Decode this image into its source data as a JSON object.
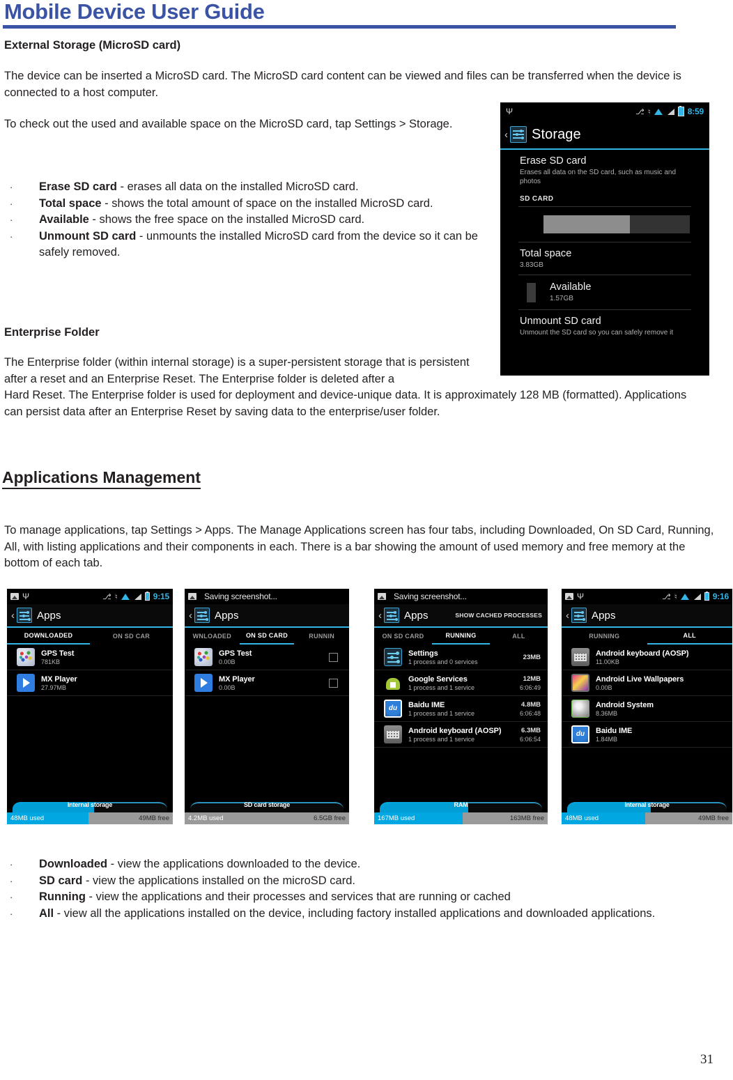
{
  "header": {
    "title": "Mobile Device User Guide"
  },
  "page_number": "31",
  "sections": {
    "external_storage": {
      "heading": "External Storage (MicroSD card)",
      "para1": "The device can be inserted a MicroSD card. The MicroSD card content can be viewed and files can be transferred when the device is connected to a host computer.",
      "para2": "To check out the used and available space on the MicroSD card, tap Settings > Storage.",
      "bullets": [
        {
          "mark": "·",
          "term": "Erase SD card",
          "rest": " - erases all data on the installed MicroSD card."
        },
        {
          "mark": "·",
          "term": "Total space",
          "rest": " - shows the total amount of space on the installed MicroSD card."
        },
        {
          "mark": "·",
          "term": "Available",
          "rest": " - shows the free space on the installed MicroSD card."
        },
        {
          "mark": "·",
          "term": "Unmount SD card",
          "rest": " - unmounts the installed MicroSD card from the device so it can be safely removed."
        }
      ]
    },
    "enterprise_folder": {
      "heading": "Enterprise Folder",
      "para_narrow": "The Enterprise folder (within internal storage) is a super-persistent storage that is persistent after a reset and an Enterprise Reset. The Enterprise folder is deleted after a",
      "para_wide": "Hard Reset. The Enterprise folder is used for deployment and device-unique data. It is approximately 128 MB (formatted). Applications can persist data after an Enterprise Reset by saving data to the enterprise/user folder."
    },
    "applications_management": {
      "heading": "Applications Management",
      "para1": "To manage applications, tap Settings > Apps. The Manage Applications screen has four tabs, including Downloaded, On SD Card, Running, All, with listing applications and their components in each. There is a bar showing the amount of used memory and free memory at the bottom of each tab.",
      "bullets": [
        {
          "mark": "·",
          "term": "Downloaded",
          "rest": " - view the applications downloaded to the device."
        },
        {
          "mark": "·",
          "term": "SD card",
          "rest": " - view the applications installed on the microSD card."
        },
        {
          "mark": "·",
          "term": "Running",
          "rest": " - view the applications and their processes and services that are running or cached"
        },
        {
          "mark": "·",
          "term": "All",
          "rest": " - view all the applications installed on the device, including factory installed applications and downloaded applications."
        }
      ]
    }
  },
  "storage_screenshot": {
    "statusbar": {
      "clock": "8:59"
    },
    "title": "Storage",
    "erase": {
      "title": "Erase SD card",
      "subtitle": "Erases all data on the SD card, such as music and photos"
    },
    "category": "SD CARD",
    "bar_used_percent": 59,
    "total_space": {
      "label": "Total space",
      "value": "3.83GB"
    },
    "available": {
      "label": "Available",
      "value": "1.57GB"
    },
    "unmount": {
      "title": "Unmount SD card",
      "subtitle": "Unmount the SD card so you can safely remove it"
    }
  },
  "app_screenshots": [
    {
      "statusbar": {
        "clock": "9:15",
        "note": ""
      },
      "title": "Apps",
      "action": "",
      "tabs": [
        {
          "label": "DOWNLOADED",
          "active": true
        },
        {
          "label": "ON SD CAR",
          "active": false
        }
      ],
      "rows": [
        {
          "icon": "gps-test-icon",
          "name": "GPS Test",
          "size": "781KB"
        },
        {
          "icon": "mx-player-icon",
          "name": "MX Player",
          "size": "27.97MB"
        }
      ],
      "meter": {
        "label": "Internal storage",
        "used": "48MB used",
        "free": "49MB free",
        "used_percent": 49
      }
    },
    {
      "statusbar": {
        "clock": "",
        "note": "Saving screenshot..."
      },
      "title": "Apps",
      "action": "",
      "tabs": [
        {
          "label": "WNLOADED",
          "active": false
        },
        {
          "label": "ON SD CARD",
          "active": true
        },
        {
          "label": "RUNNIN",
          "active": false
        }
      ],
      "rows": [
        {
          "icon": "gps-test-icon",
          "name": "GPS Test",
          "size": "0.00B",
          "checkbox": true
        },
        {
          "icon": "mx-player-icon",
          "name": "MX Player",
          "size": "0.00B",
          "checkbox": true
        }
      ],
      "meter": {
        "label": "SD card storage",
        "used": "4.2MB used",
        "free": "6.5GB free",
        "used_percent": 0
      }
    },
    {
      "statusbar": {
        "clock": "",
        "note": "Saving screenshot..."
      },
      "title": "Apps",
      "action": "SHOW CACHED PROCESSES",
      "tabs": [
        {
          "label": "ON SD CARD",
          "active": false
        },
        {
          "label": "RUNNING",
          "active": true
        },
        {
          "label": "ALL",
          "active": false
        }
      ],
      "rows": [
        {
          "icon": "settings-icon",
          "name": "Settings",
          "size": "1 process and 0 services",
          "right_size": "23MB",
          "right_time": ""
        },
        {
          "icon": "google-services-icon",
          "name": "Google Services",
          "size": "1 process and 1 service",
          "right_size": "12MB",
          "right_time": "6:06:49"
        },
        {
          "icon": "baidu-ime-icon",
          "name": "Baidu IME",
          "size": "1 process and 1 service",
          "right_size": "4.8MB",
          "right_time": "6:06:48"
        },
        {
          "icon": "android-keyboard-icon",
          "name": "Android keyboard (AOSP)",
          "size": "1 process and 1 service",
          "right_size": "6.3MB",
          "right_time": "6:06:54"
        }
      ],
      "meter": {
        "label": "RAM",
        "used": "167MB used",
        "free": "163MB free",
        "used_percent": 51
      }
    },
    {
      "statusbar": {
        "clock": "9:16",
        "note": ""
      },
      "title": "Apps",
      "action": "",
      "tabs": [
        {
          "label": "RUNNING",
          "active": false
        },
        {
          "label": "ALL",
          "active": true
        }
      ],
      "rows": [
        {
          "icon": "android-keyboard-icon",
          "name": "Android keyboard (AOSP)",
          "size": "11.00KB"
        },
        {
          "icon": "android-live-wallpapers-icon",
          "name": "Android Live Wallpapers",
          "size": "0.00B"
        },
        {
          "icon": "android-system-icon",
          "name": "Android System",
          "size": "8.36MB"
        },
        {
          "icon": "baidu-ime-icon",
          "name": "Baidu IME",
          "size": "1.84MB"
        }
      ],
      "meter": {
        "label": "Internal storage",
        "used": "48MB used",
        "free": "49MB free",
        "used_percent": 49
      }
    }
  ]
}
